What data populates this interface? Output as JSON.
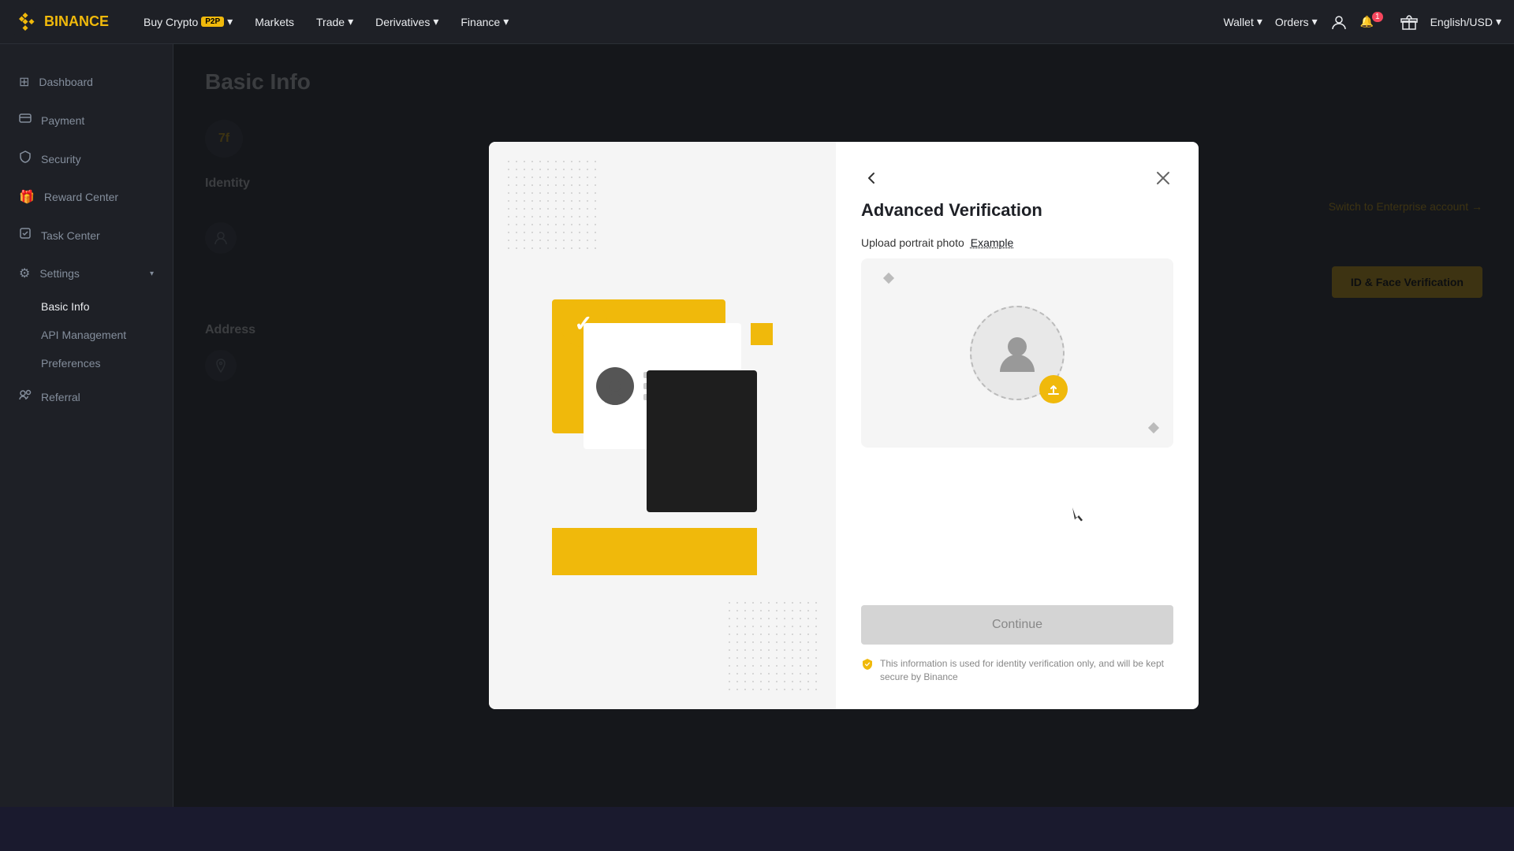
{
  "navbar": {
    "logo_text": "BINANCE",
    "links": [
      {
        "label": "Buy Crypto",
        "badge": "P2P",
        "has_dropdown": true
      },
      {
        "label": "Markets",
        "has_dropdown": false
      },
      {
        "label": "Trade",
        "has_dropdown": true
      },
      {
        "label": "Derivatives",
        "has_dropdown": true
      },
      {
        "label": "Finance",
        "has_dropdown": true
      }
    ],
    "right_items": [
      {
        "label": "Wallet",
        "has_dropdown": true
      },
      {
        "label": "Orders",
        "has_dropdown": true
      }
    ],
    "language": "English/USD"
  },
  "sidebar": {
    "items": [
      {
        "label": "Dashboard",
        "icon": "⊞"
      },
      {
        "label": "Payment",
        "icon": "💳"
      },
      {
        "label": "Security",
        "icon": "🔒"
      },
      {
        "label": "Reward Center",
        "icon": "🎁"
      },
      {
        "label": "Task Center",
        "icon": "✓"
      },
      {
        "label": "Settings",
        "icon": "⚙",
        "has_sub": true,
        "sub_items": [
          {
            "label": "Basic Info"
          },
          {
            "label": "API Management"
          },
          {
            "label": "Preferences"
          }
        ]
      },
      {
        "label": "Referral",
        "icon": "👥"
      }
    ]
  },
  "content": {
    "page_title": "Basic Info",
    "avatar_initials": "7f",
    "identity_section_title": "Identity",
    "address_section_title": "Address",
    "enterprise_link": "Switch to Enterprise account →",
    "verify_btn_label": "ID & Face Verification"
  },
  "modal": {
    "title": "Advanced Verification",
    "back_btn": "←",
    "close_btn": "✕",
    "upload_label": "Upload portrait photo",
    "example_label": "Example",
    "continue_btn": "Continue",
    "security_note": "This information is used for identity verification only, and will be kept secure by Binance"
  }
}
